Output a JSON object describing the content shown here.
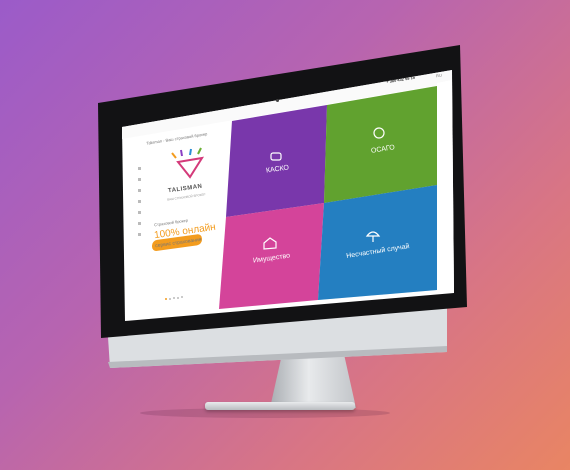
{
  "site": {
    "brand": "TALISMAN",
    "brand_sub": "ВАШ СТРАХОВОЙ БРОКЕР",
    "tagline_top": "Страховой брокер",
    "highlight": "100% онлайн",
    "tagline_bottom": "сервис страхования",
    "cta": "Оформить полис онлайн",
    "phone": "+ 380 432 55 15",
    "lang": "RU",
    "breadcrumb": "Talisman - Ваш страховой брокер"
  },
  "tiles": [
    {
      "label": "КАСКО",
      "icon": "car-icon",
      "color": "#8a3fc3"
    },
    {
      "label": "ОСАГО",
      "icon": "steering-wheel-icon",
      "color": "#6ab034"
    },
    {
      "label": "Имущество",
      "icon": "house-icon",
      "color": "#d4449a"
    },
    {
      "label": "Несчастный случай",
      "icon": "umbrella-icon",
      "color": "#2a8fd6"
    }
  ],
  "colors": {
    "accent": "#f39c1e"
  }
}
